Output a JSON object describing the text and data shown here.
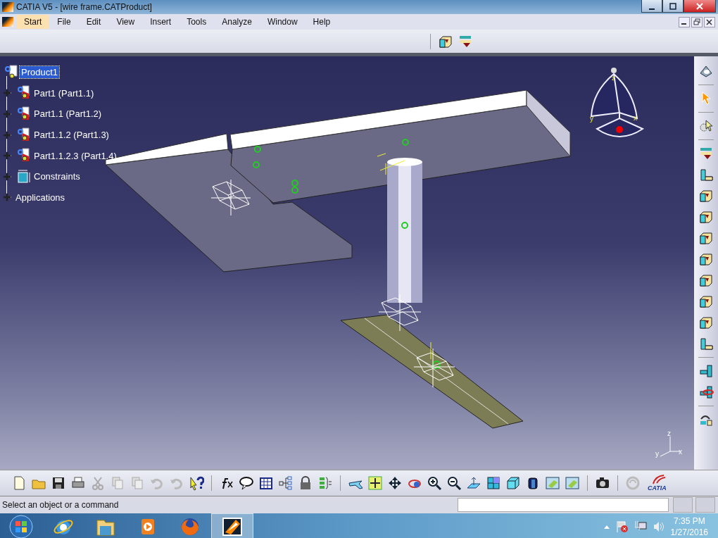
{
  "window": {
    "title": "CATIA V5 - [wire frame.CATProduct]"
  },
  "menu": [
    {
      "label": "Start",
      "selected": true
    },
    {
      "label": "File",
      "selected": false
    },
    {
      "label": "Edit",
      "selected": false
    },
    {
      "label": "View",
      "selected": false
    },
    {
      "label": "Insert",
      "selected": false
    },
    {
      "label": "Tools",
      "selected": false
    },
    {
      "label": "Analyze",
      "selected": false
    },
    {
      "label": "Window",
      "selected": false
    },
    {
      "label": "Help",
      "selected": false
    }
  ],
  "tree": {
    "root": {
      "label": "Product1",
      "selected": true
    },
    "children": [
      {
        "label": "Part1 (Part1.1)",
        "kind": "part",
        "selected": false
      },
      {
        "label": "Part1.1 (Part1.2)",
        "kind": "part",
        "selected": false
      },
      {
        "label": "Part1.1.2 (Part1.3)",
        "kind": "part",
        "selected": false
      },
      {
        "label": "Part1.1.2.3 (Part1.4)",
        "kind": "part",
        "selected": false
      },
      {
        "label": "Constraints",
        "kind": "constraints",
        "selected": false
      },
      {
        "label": "Applications",
        "kind": "applications",
        "selected": false
      }
    ]
  },
  "compass": {
    "axes": [
      "z",
      "y",
      "x"
    ]
  },
  "axis_triad": {
    "axes": [
      "z",
      "y",
      "x"
    ]
  },
  "logo": {
    "text": "CATIA"
  },
  "status_bar": {
    "message": "Select an object or a command"
  },
  "taskbar": {
    "time": "7:35 PM",
    "date": "1/27/2016"
  }
}
